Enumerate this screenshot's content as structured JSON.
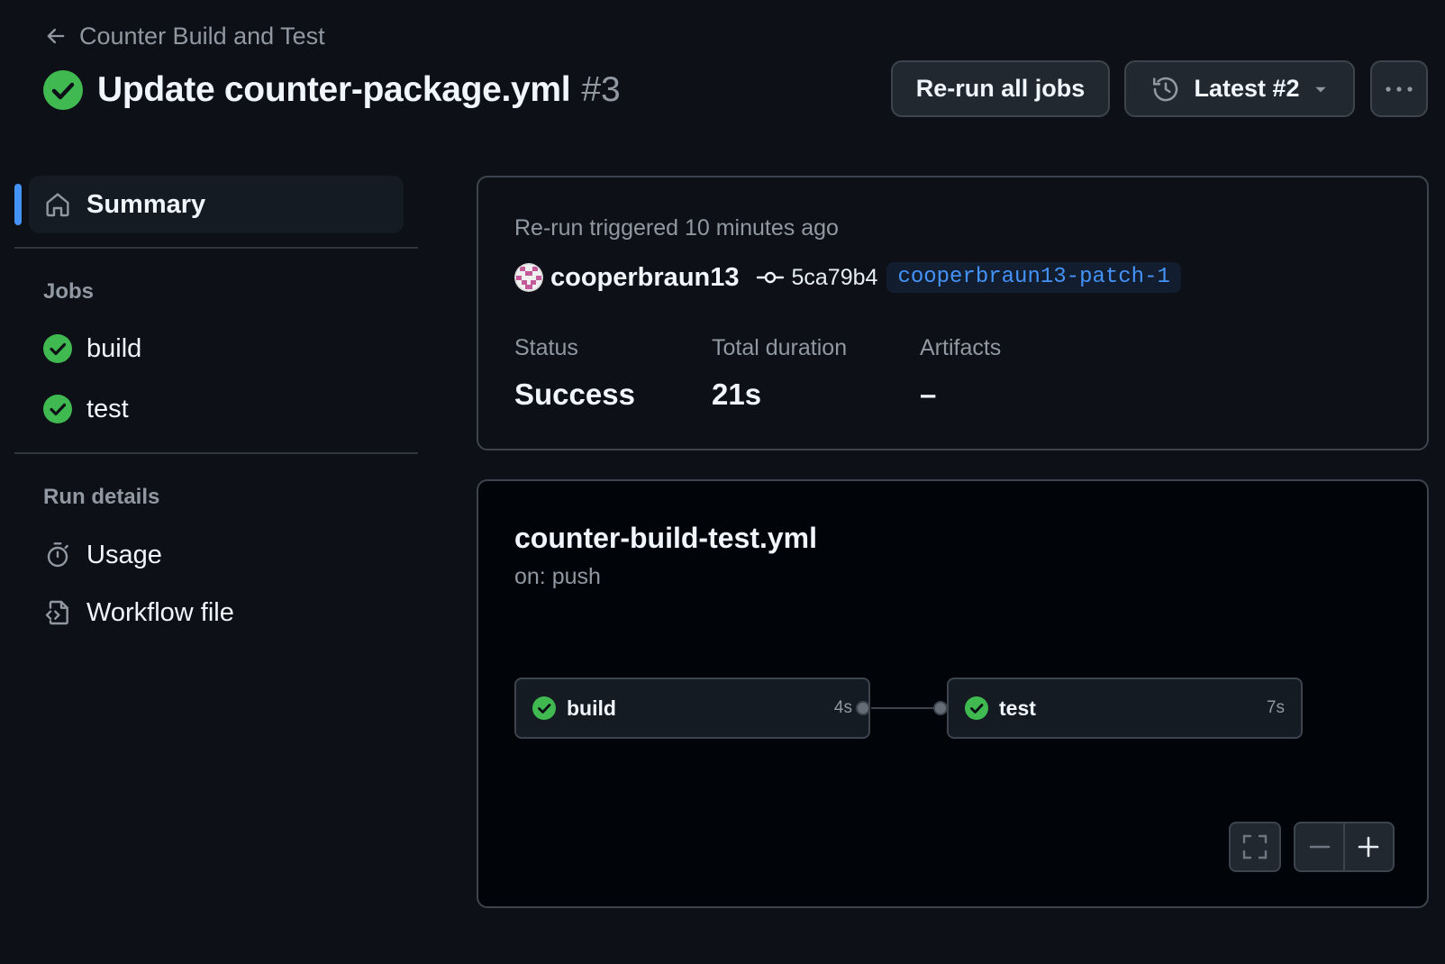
{
  "header": {
    "back_label": "Counter Build and Test",
    "run_title": "Update counter-package.yml",
    "run_number": "#3",
    "rerun_button": "Re-run all jobs",
    "attempt_button": "Latest #2"
  },
  "sidebar": {
    "summary_label": "Summary",
    "jobs_heading": "Jobs",
    "jobs": [
      {
        "name": "build",
        "status": "success"
      },
      {
        "name": "test",
        "status": "success"
      }
    ],
    "run_details_heading": "Run details",
    "run_details": [
      {
        "label": "Usage",
        "icon": "stopwatch-icon"
      },
      {
        "label": "Workflow file",
        "icon": "file-code-icon"
      }
    ]
  },
  "summary": {
    "trigger_text": "Re-run triggered 10 minutes ago",
    "actor": "cooperbraun13",
    "commit_sha": "5ca79b4",
    "branch": "cooperbraun13-patch-1",
    "stats": [
      {
        "label": "Status",
        "value": "Success"
      },
      {
        "label": "Total duration",
        "value": "21s"
      },
      {
        "label": "Artifacts",
        "value": "–"
      }
    ]
  },
  "graph": {
    "workflow_file": "counter-build-test.yml",
    "trigger": "on: push",
    "jobs": [
      {
        "name": "build",
        "duration": "4s"
      },
      {
        "name": "test",
        "duration": "7s"
      }
    ]
  },
  "colors": {
    "background": "#0d1117",
    "success": "#3fb950",
    "accent": "#4493f8",
    "muted_text": "#9198a1"
  }
}
